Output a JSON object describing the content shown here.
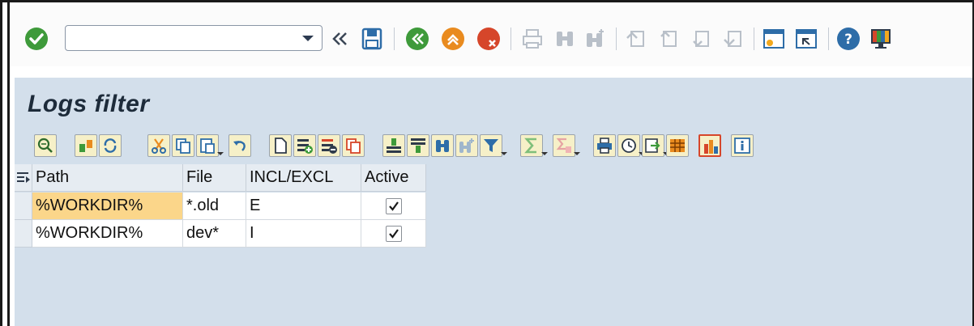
{
  "window": {
    "title": "Logs filter"
  },
  "toolbar": {
    "okcode_value": "",
    "icons": [
      "enter-check-icon",
      "okcode-dropdown-icon",
      "collapse-icon",
      "save-icon",
      "back-icon",
      "exit-icon",
      "cancel-icon",
      "print-icon",
      "find-icon",
      "find-next-icon",
      "first-page-icon",
      "previous-page-icon",
      "next-page-icon",
      "last-page-icon",
      "create-session-icon",
      "shortcut-icon",
      "help-icon",
      "customize-layout-icon"
    ]
  },
  "grid": {
    "columns": [
      "Path",
      "File",
      "INCL/EXCL",
      "Active"
    ],
    "rows": [
      {
        "path": "%WORKDIR%",
        "file": "*.old",
        "incl_excl": "E",
        "active": true
      },
      {
        "path": "%WORKDIR%",
        "file": "dev*",
        "incl_excl": "I",
        "active": true
      }
    ]
  },
  "colors": {
    "accent_green": "#3e9a3a",
    "accent_orange": "#e98b1f",
    "accent_red": "#d6462a",
    "body_bg": "#d3dfeb",
    "selected_cell": "#fbd68a"
  }
}
